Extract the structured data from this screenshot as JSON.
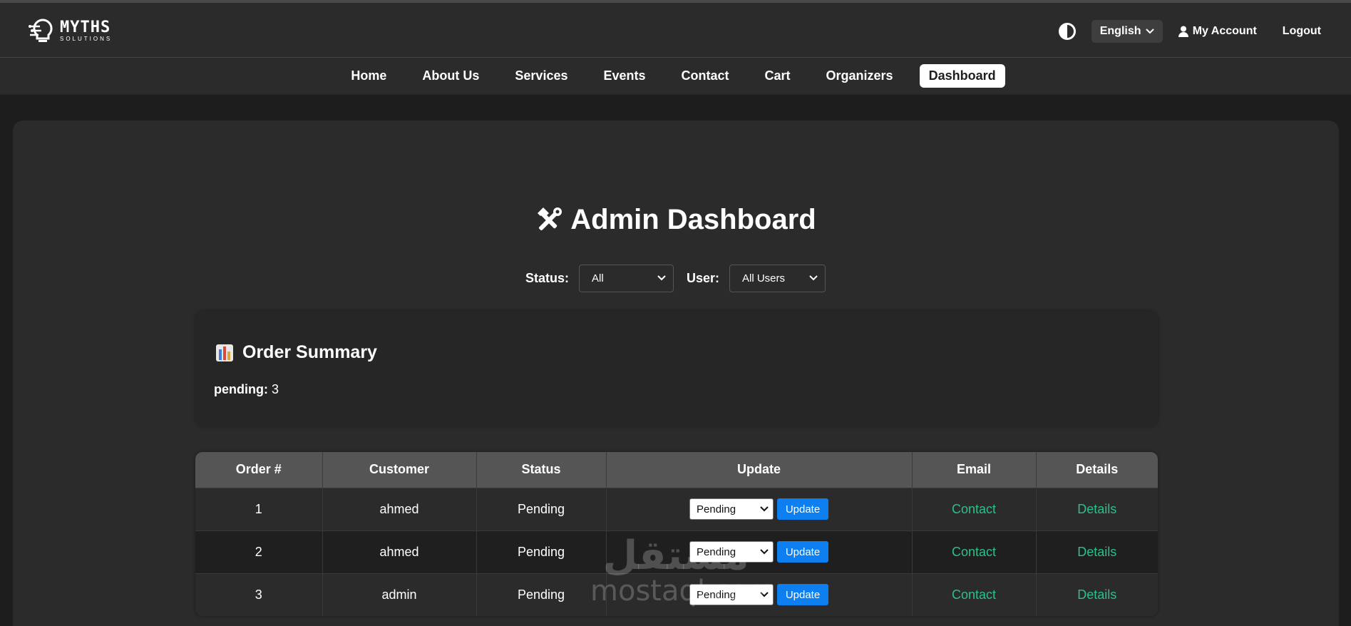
{
  "brand": {
    "name": "MYTHS",
    "tagline": "SOLUTIONS"
  },
  "header": {
    "language": "English",
    "account": "My Account",
    "logout": "Logout"
  },
  "nav": {
    "items": [
      {
        "label": "Home",
        "active": false
      },
      {
        "label": "About Us",
        "active": false
      },
      {
        "label": "Services",
        "active": false
      },
      {
        "label": "Events",
        "active": false
      },
      {
        "label": "Contact",
        "active": false
      },
      {
        "label": "Cart",
        "active": false
      },
      {
        "label": "Organizers",
        "active": false
      },
      {
        "label": "Dashboard",
        "active": true
      }
    ]
  },
  "dashboard": {
    "title": "Admin Dashboard",
    "filters": {
      "status_label": "Status:",
      "status_value": "All",
      "user_label": "User:",
      "user_value": "All Users"
    },
    "summary": {
      "title": "Order Summary",
      "key": "pending:",
      "value": "3"
    },
    "table": {
      "headers": [
        "Order #",
        "Customer",
        "Status",
        "Update",
        "Email",
        "Details"
      ],
      "rows": [
        {
          "order": "1",
          "customer": "ahmed",
          "status": "Pending",
          "select": "Pending",
          "button": "Update",
          "email": "Contact",
          "details": "Details"
        },
        {
          "order": "2",
          "customer": "ahmed",
          "status": "Pending",
          "select": "Pending",
          "button": "Update",
          "email": "Contact",
          "details": "Details"
        },
        {
          "order": "3",
          "customer": "admin",
          "status": "Pending",
          "select": "Pending",
          "button": "Update",
          "email": "Contact",
          "details": "Details"
        }
      ]
    }
  },
  "watermark": {
    "arabic": "مستقل",
    "latin": "mostaql.com"
  },
  "colors": {
    "accent_blue": "#0d7ff0",
    "link_green": "#2fbf8a",
    "header_bg": "#2b2b2b",
    "table_header_bg": "#555555"
  },
  "icons": {
    "theme": "contrast-icon",
    "account": "user-icon",
    "title": "hammer-wrench-icon",
    "summary": "bar-chart-icon"
  }
}
